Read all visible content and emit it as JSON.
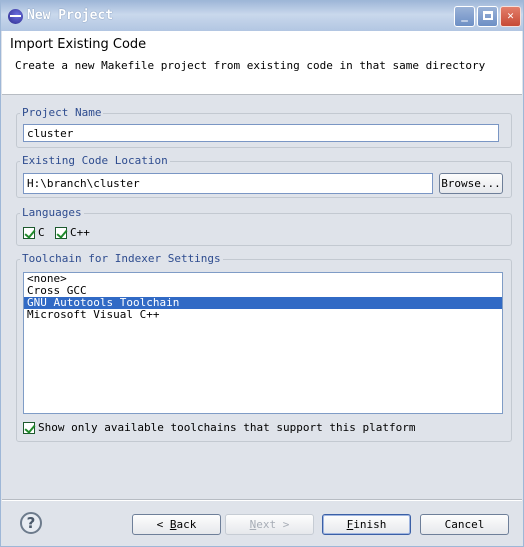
{
  "window": {
    "title": "New Project",
    "controls": {
      "minimize": "_",
      "maximize": "",
      "close": "✕"
    }
  },
  "header": {
    "title": "Import Existing Code",
    "description": "Create a new Makefile project from existing code in that same directory"
  },
  "project_name": {
    "label": "Project Name",
    "value": "cluster"
  },
  "code_location": {
    "label": "Existing Code Location",
    "value": "H:\\branch\\cluster",
    "browse_label": "Browse..."
  },
  "languages": {
    "label": "Languages",
    "items": [
      {
        "label": "C",
        "checked": true
      },
      {
        "label": "C++",
        "checked": true
      }
    ]
  },
  "toolchain": {
    "label": "Toolchain for Indexer Settings",
    "items": [
      {
        "label": "<none>",
        "selected": false
      },
      {
        "label": "Cross GCC",
        "selected": false
      },
      {
        "label": "GNU Autotools Toolchain",
        "selected": true
      },
      {
        "label": "Microsoft Visual C++",
        "selected": false
      }
    ],
    "show_only_label": "Show only available toolchains that support this platform",
    "show_only_checked": true
  },
  "buttons": {
    "help_glyph": "?",
    "back_prefix": "< ",
    "back_mnemonic": "B",
    "back_rest": "ack",
    "next_mnemonic": "N",
    "next_rest": "ext >",
    "finish_mnemonic": "F",
    "finish_rest": "inish",
    "cancel": "Cancel"
  }
}
